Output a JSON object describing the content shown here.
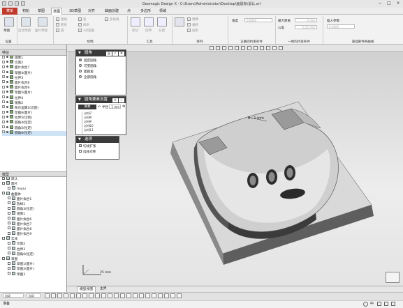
{
  "window": {
    "title": "Geomagic Design X - C:\\Users\\Administrator\\Desktop\\画鼠标\\鼠认.xrl"
  },
  "menu": {
    "file": "菜单",
    "items": [
      "初始",
      "草图",
      "3D草图",
      "对齐",
      "曲面创建",
      "点",
      "多边形",
      "领域"
    ],
    "active": "草图"
  },
  "ribbon": {
    "group_setup": "设置",
    "group_draw": "绘制",
    "group_tools": "工具",
    "group_pattern": "阵列",
    "group_fit": "正确的约束条件",
    "group_constraint": "一致的约束条件",
    "group_extra": "基础部件各曲线",
    "btn_sketch": "草图",
    "btn_extract": "自动草图",
    "btn_offset": "面片草图",
    "draw_items": [
      "直线",
      "矩形",
      "圆",
      "弧",
      "样条",
      "多段线",
      "3点圆弧"
    ],
    "tool_items": [
      "剪切",
      "延伸",
      "分割"
    ],
    "pattern_items": [
      "镜像",
      "偏移",
      "投影"
    ],
    "angle_label": "角度",
    "angle_value": "0.0000",
    "max_distance_label": "最大距离",
    "max_distance_value": "0 mm",
    "tolerance_label": "公差",
    "tolerance_value": "0.25 mm",
    "insert_param_label": "插入参数",
    "insert_param_value": "0.0000"
  },
  "left_panel": {
    "feature_header": "特征",
    "tree": [
      "镜像1",
      "切割2",
      "面片拟合7",
      "草图4(面片)",
      "拉伸3",
      "面片拟合8",
      "面片拟合9",
      "草图5(面片)",
      "拉伸4",
      "镜像2",
      "布尔运算2(切割)",
      "草图6(面片)",
      "拉伸5(切割)",
      "圆角4(恒定)",
      "圆角5(恒定)",
      "圆角6(恒定)"
    ],
    "model_header": "模型",
    "model_tree": [
      {
        "label": "默认",
        "level": 0
      },
      {
        "label": "面片",
        "level": 0
      },
      {
        "label": "mujiu",
        "level": 1
      },
      {
        "label": "曲面体",
        "level": 0
      },
      {
        "label": "面片拟合1",
        "level": 1
      },
      {
        "label": "放样1",
        "level": 1
      },
      {
        "label": "圆角3(恒定)",
        "level": 1
      },
      {
        "label": "镜像1",
        "level": 1
      },
      {
        "label": "面片拟合6",
        "level": 1
      },
      {
        "label": "面片拟合7",
        "level": 1
      },
      {
        "label": "面片拟合8",
        "level": 1
      },
      {
        "label": "面片拟合9",
        "level": 1
      },
      {
        "label": "实体",
        "level": 0
      },
      {
        "label": "切割2",
        "level": 1
      },
      {
        "label": "拉伸3",
        "level": 1
      },
      {
        "label": "圆角6(恒定)",
        "level": 1
      },
      {
        "label": "草图",
        "level": 0
      },
      {
        "label": "草图1(面片)",
        "level": 1
      },
      {
        "label": "草图2(面片)",
        "level": 1
      },
      {
        "label": "草图3",
        "level": 1
      }
    ]
  },
  "fillet_dialog": {
    "title": "圆角",
    "modes": [
      "固定圆角",
      "可变圆角",
      "面圆角",
      "全部圆角"
    ],
    "selected_mode": 0,
    "section_edges": "圆角要素设置",
    "edge_tag": "要素",
    "radius_label": "半径",
    "radius_value": "1 mm",
    "edge_list": [
      "边线7",
      "边线8",
      "边线9",
      "边线10",
      "边线11"
    ],
    "section_options": "选项",
    "opt_tangent": "切线扩张",
    "opt_tangent_checked": true,
    "opt_setback": "选择对称",
    "opt_setback_checked": false
  },
  "viewport": {
    "dimension_label": "R : 1 mm",
    "scale_label": "25 mm"
  },
  "bottom_tabs": [
    "模型视图",
    "主界"
  ],
  "statusbar": {
    "mode_select": "自动",
    "ready": "准备"
  },
  "taskbar": {
    "lang": "中",
    "time": "中"
  },
  "colors": {
    "accent": "#c0392b",
    "dialog_header": "#3a3a3a",
    "part_top": "#d6d6d6",
    "part_side": "#6a6a6a"
  }
}
